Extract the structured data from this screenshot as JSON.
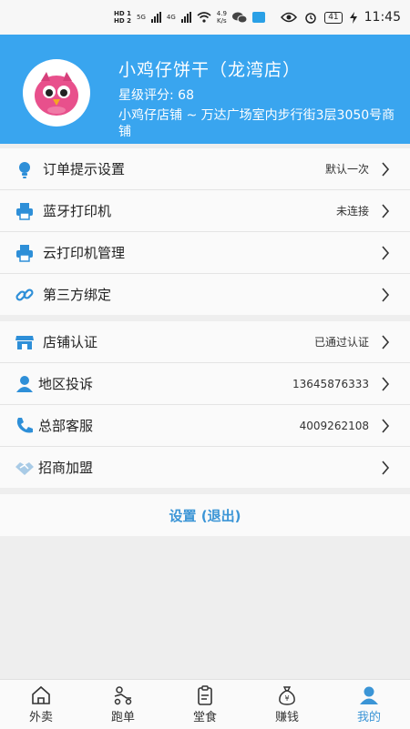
{
  "status_bar": {
    "hd1": "HD 1",
    "hd2": "HD 2",
    "net_5g": "5G",
    "net_4g": "4G",
    "speed": "4.9",
    "speed_unit": "K/s",
    "battery": "41",
    "time": "11:45"
  },
  "header": {
    "shop_name": "小鸡仔饼干（龙湾店）",
    "rating": "星级评分: 68",
    "address": "小鸡仔店铺 ~ 万达广场室内步行街3层3050号商铺"
  },
  "group1": [
    {
      "icon": "bulb-icon",
      "label": "订单提示设置",
      "value": "默认一次"
    },
    {
      "icon": "printer-icon",
      "label": "蓝牙打印机",
      "value": "未连接"
    },
    {
      "icon": "printer-icon",
      "label": "云打印机管理",
      "value": ""
    },
    {
      "icon": "link-icon",
      "label": "第三方绑定",
      "value": ""
    }
  ],
  "group2": [
    {
      "icon": "store-icon",
      "label": "店铺认证",
      "value": "已通过认证"
    },
    {
      "icon": "person-icon",
      "label": "地区投诉",
      "value": "13645876333"
    },
    {
      "icon": "phone-icon",
      "label": "总部客服",
      "value": "4009262108"
    },
    {
      "icon": "handshake-icon",
      "label": "招商加盟",
      "value": ""
    }
  ],
  "logout": "设置 (退出)",
  "nav": [
    {
      "icon": "home-icon",
      "label": "外卖",
      "active": false
    },
    {
      "icon": "courier-icon",
      "label": "跑单",
      "active": false
    },
    {
      "icon": "clipboard-icon",
      "label": "堂食",
      "active": false
    },
    {
      "icon": "money-bag-icon",
      "label": "赚钱",
      "active": false
    },
    {
      "icon": "profile-icon",
      "label": "我的",
      "active": true
    }
  ],
  "colors": {
    "header_bg": "#39a5ef",
    "accent": "#3b95d6",
    "icon_blue": "#2e8fd8"
  }
}
